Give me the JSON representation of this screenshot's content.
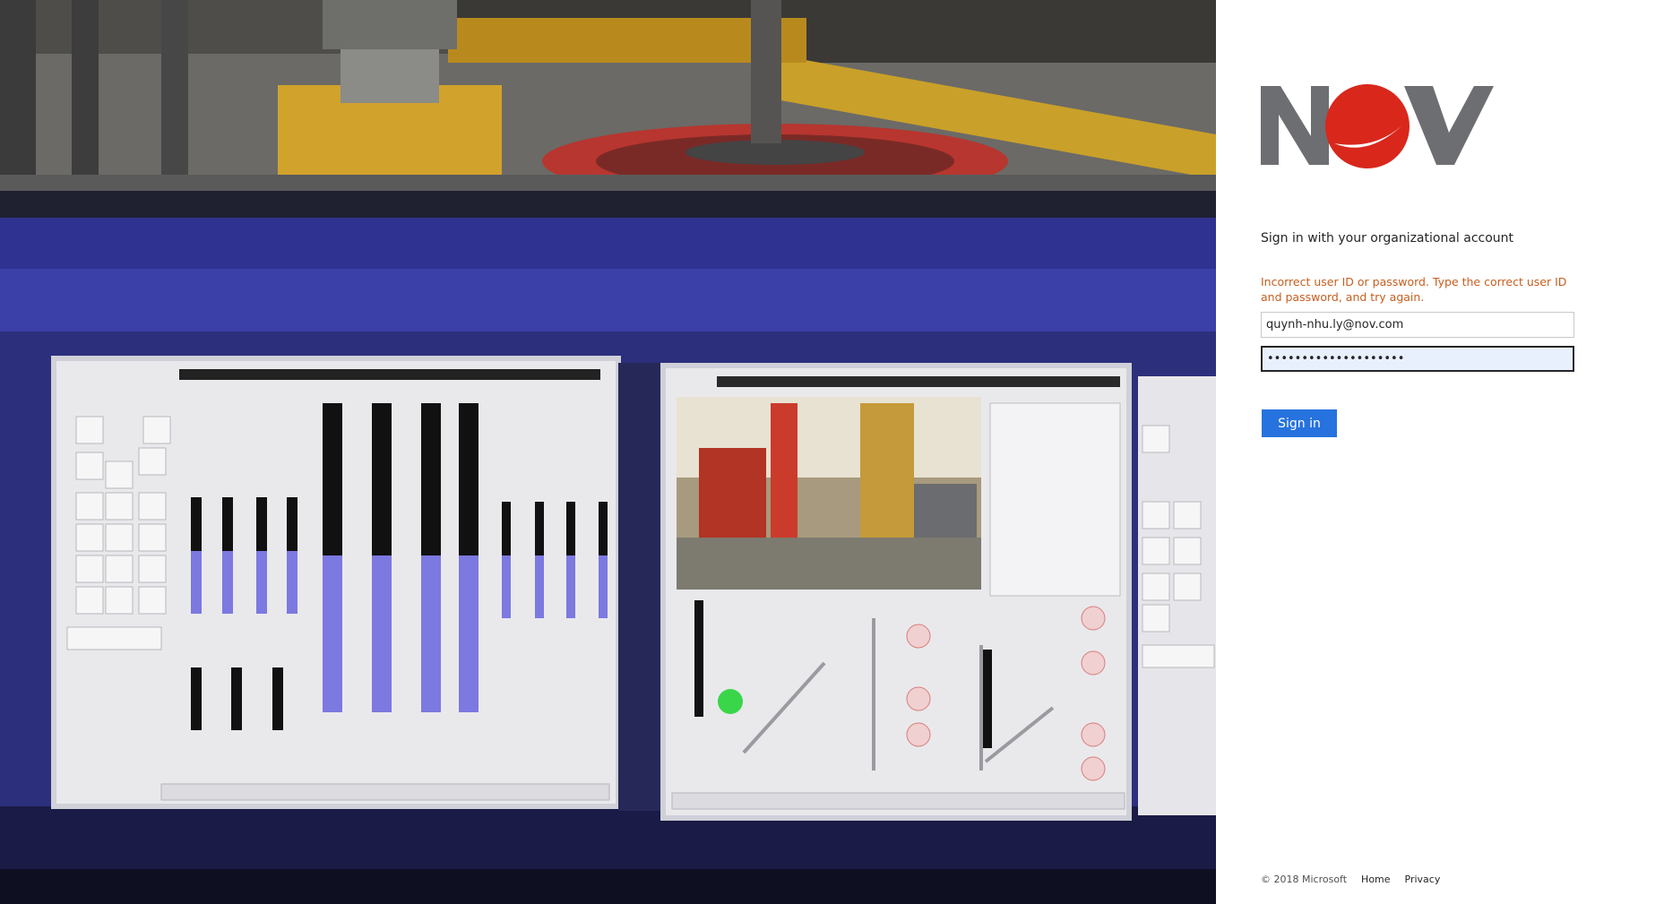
{
  "login": {
    "heading": "Sign in with your organizational account",
    "error": "Incorrect user ID or password. Type the correct user ID and password, and try again.",
    "email_value": "quynh-nhu.ly@nov.com",
    "password_value": "••••••••••••••••••••",
    "signin_label": "Sign in"
  },
  "logo": {
    "text": "NOV",
    "brand_red": "#d9271c",
    "brand_grey": "#6d6e71"
  },
  "footer": {
    "copyright": "© 2018 Microsoft",
    "home": "Home",
    "privacy": "Privacy"
  },
  "colors": {
    "accent": "#2672de",
    "error": "#c65e1f"
  },
  "illustration": {
    "description_icon": "drilling-control-room-image"
  }
}
